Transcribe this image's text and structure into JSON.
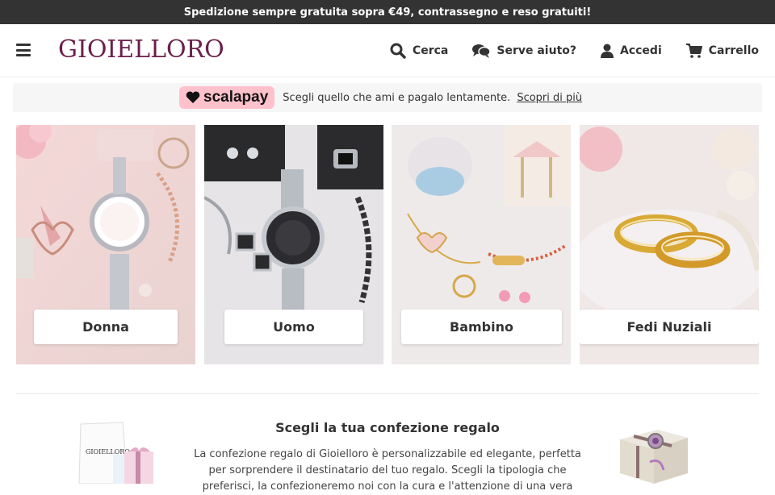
{
  "topbar": {
    "text": "Spedizione sempre gratuita sopra €49, contrassegno e reso gratuiti!"
  },
  "header": {
    "logo": "GIOIELLORO",
    "nav": [
      {
        "label": "Cerca",
        "icon": "search-icon"
      },
      {
        "label": "Serve aiuto?",
        "icon": "chat-icon"
      },
      {
        "label": "Accedi",
        "icon": "user-icon"
      },
      {
        "label": "Carrello",
        "icon": "cart-icon"
      }
    ]
  },
  "scalapay": {
    "brand": "scalapay",
    "text": "Scegli quello che ami e pagalo lentamente.",
    "link": "Scopri di più",
    "color": "#ffc1cc"
  },
  "categories": [
    {
      "label": "Donna"
    },
    {
      "label": "Uomo"
    },
    {
      "label": "Bambino"
    },
    {
      "label": "Fedi Nuziali"
    }
  ],
  "gift": {
    "title": "Scegli la tua confezione regalo",
    "text": "La confezione regalo di Gioielloro è personalizzabile ed elegante, perfetta per sorprendere il destinatario del tuo regalo. Scegli la tipologia che preferisci, la confezioneremo noi con la cura e l'attenzione di una vera",
    "box_logo": "GIOIELLORO"
  },
  "colors": {
    "brand": "#6b1f4b",
    "topbar": "#333333"
  }
}
